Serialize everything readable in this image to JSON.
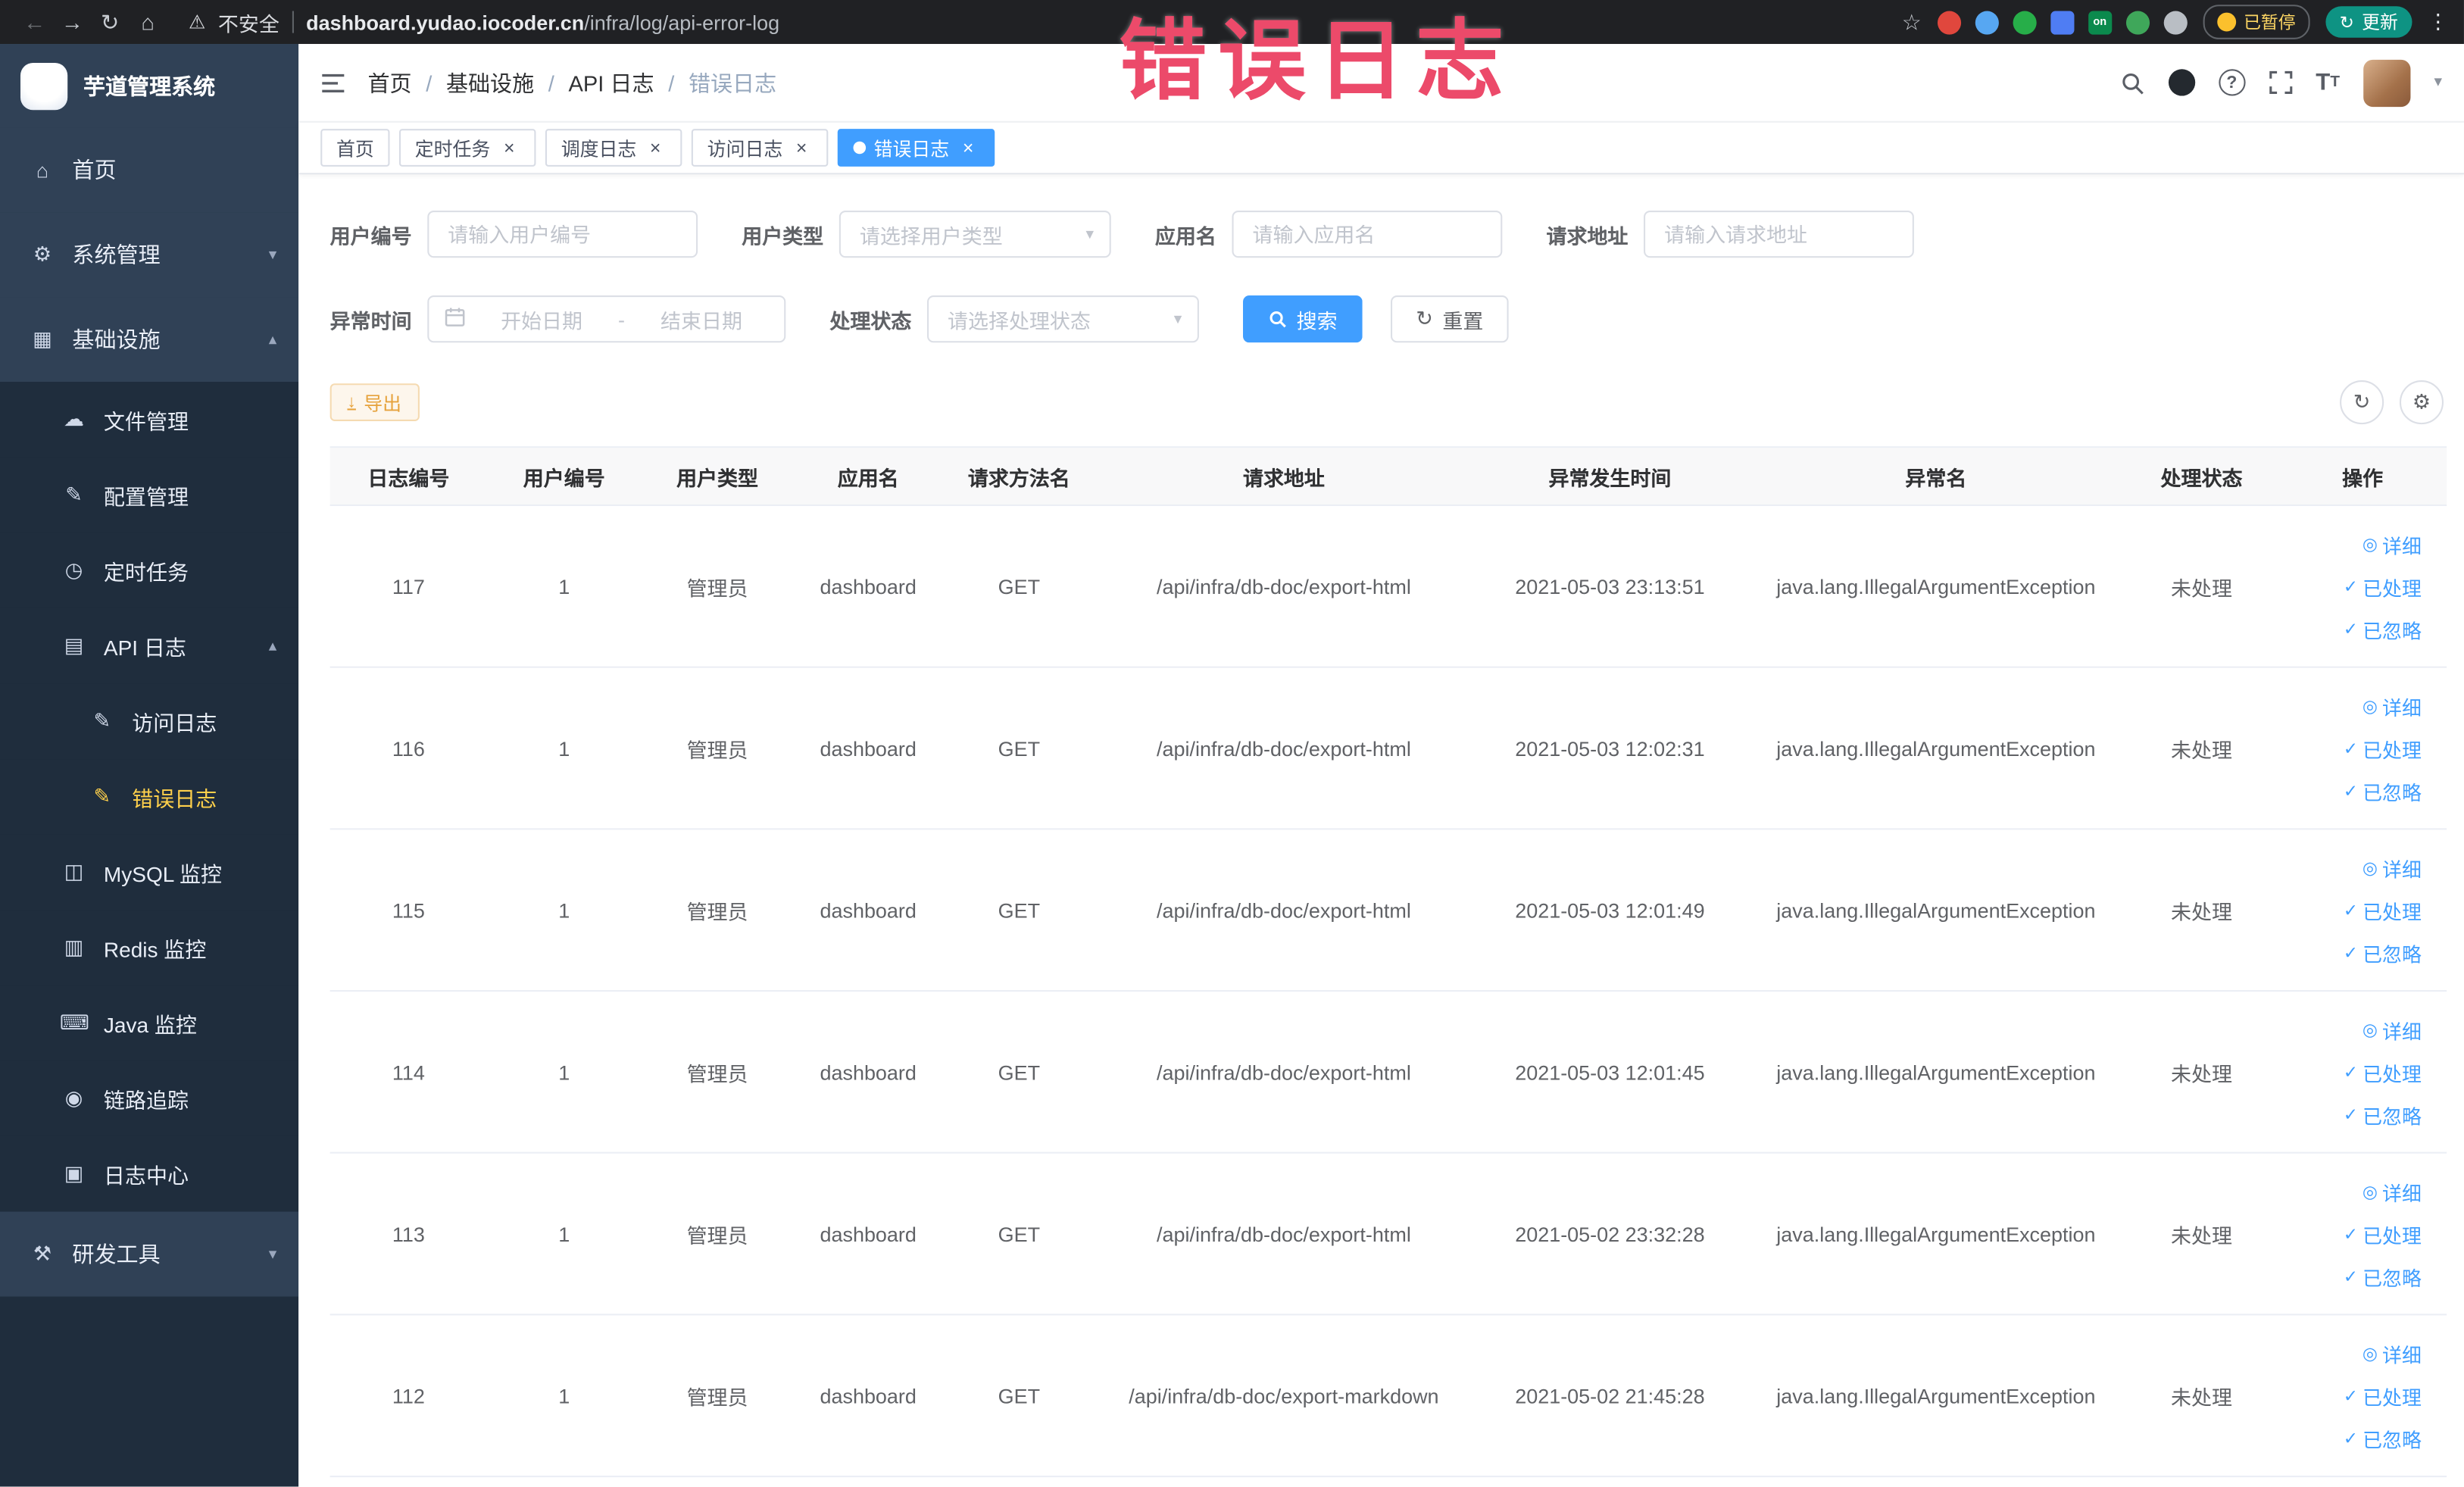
{
  "annotation": {
    "text": "错误日志"
  },
  "browser": {
    "security_label": "不安全",
    "url_domain": "dashboard.yudao.iocoder.cn",
    "url_path": "/infra/log/api-error-log",
    "paused_label": "已暂停",
    "update_label": "更新",
    "extensions": [
      {
        "name": "extension-red-icon",
        "color": "#e0473d"
      },
      {
        "name": "extension-blue-icon",
        "color": "#57a7f2"
      },
      {
        "name": "extension-green-circle-icon",
        "color": "#27ae49"
      },
      {
        "name": "extension-blue-grid-icon",
        "color": "#4f7df3",
        "shape": "square"
      },
      {
        "name": "extension-on-badge-icon",
        "color": "#0b8a4d",
        "shape": "square",
        "text": "on"
      },
      {
        "name": "extension-leaf-icon",
        "color": "#3fa75a"
      },
      {
        "name": "extension-paw-icon",
        "color": "#b9bec4"
      }
    ]
  },
  "sidebar": {
    "title": "芋道管理系统",
    "items": [
      {
        "label": "首页",
        "level": 1,
        "icon": "home-icon"
      },
      {
        "label": "系统管理",
        "level": 1,
        "icon": "gear-icon",
        "chevron": "down"
      },
      {
        "label": "基础设施",
        "level": 1,
        "icon": "infra-icon",
        "chevron": "up"
      },
      {
        "label": "文件管理",
        "level": 2,
        "icon": "file-icon"
      },
      {
        "label": "配置管理",
        "level": 2,
        "icon": "config-icon"
      },
      {
        "label": "定时任务",
        "level": 2,
        "icon": "timer-icon"
      },
      {
        "label": "API 日志",
        "level": 2,
        "icon": "api-log-icon",
        "chevron": "up"
      },
      {
        "label": "访问日志",
        "level": 3,
        "icon": "access-log-icon"
      },
      {
        "label": "错误日志",
        "level": 3,
        "icon": "error-log-icon",
        "active": true
      },
      {
        "label": "MySQL 监控",
        "level": 2,
        "icon": "mysql-icon"
      },
      {
        "label": "Redis 监控",
        "level": 2,
        "icon": "redis-icon"
      },
      {
        "label": "Java 监控",
        "level": 2,
        "icon": "java-icon"
      },
      {
        "label": "链路追踪",
        "level": 2,
        "icon": "trace-icon"
      },
      {
        "label": "日志中心",
        "level": 2,
        "icon": "log-center-icon"
      },
      {
        "label": "研发工具",
        "level": 1,
        "icon": "devtools-icon",
        "chevron": "down"
      }
    ]
  },
  "header": {
    "breadcrumb": [
      "首页",
      "基础设施",
      "API 日志",
      "错误日志"
    ]
  },
  "tags": [
    {
      "label": "首页",
      "closable": false,
      "active": false
    },
    {
      "label": "定时任务",
      "closable": true,
      "active": false
    },
    {
      "label": "调度日志",
      "closable": true,
      "active": false
    },
    {
      "label": "访问日志",
      "closable": true,
      "active": false
    },
    {
      "label": "错误日志",
      "closable": true,
      "active": true
    }
  ],
  "filters": {
    "user_id_label": "用户编号",
    "user_id_placeholder": "请输入用户编号",
    "user_type_label": "用户类型",
    "user_type_placeholder": "请选择用户类型",
    "app_name_label": "应用名",
    "app_name_placeholder": "请输入应用名",
    "request_url_label": "请求地址",
    "request_url_placeholder": "请输入请求地址",
    "time_label": "异常时间",
    "time_start_placeholder": "开始日期",
    "time_end_placeholder": "结束日期",
    "time_separator": "-",
    "status_label": "处理状态",
    "status_placeholder": "请选择处理状态",
    "search_label": "搜索",
    "reset_label": "重置"
  },
  "toolbar": {
    "export_label": "导出"
  },
  "table": {
    "columns": [
      "日志编号",
      "用户编号",
      "用户类型",
      "应用名",
      "请求方法名",
      "请求地址",
      "异常发生时间",
      "异常名",
      "处理状态",
      "操作"
    ],
    "action_labels": [
      "详细",
      "已处理",
      "已忽略"
    ],
    "rows": [
      {
        "id": "117",
        "user_id": "1",
        "user_type": "管理员",
        "app": "dashboard",
        "method": "GET",
        "url": "/api/infra/db-doc/export-html",
        "time": "2021-05-03 23:13:51",
        "exception": "java.lang.IllegalArgumentException",
        "status": "未处理"
      },
      {
        "id": "116",
        "user_id": "1",
        "user_type": "管理员",
        "app": "dashboard",
        "method": "GET",
        "url": "/api/infra/db-doc/export-html",
        "time": "2021-05-03 12:02:31",
        "exception": "java.lang.IllegalArgumentException",
        "status": "未处理"
      },
      {
        "id": "115",
        "user_id": "1",
        "user_type": "管理员",
        "app": "dashboard",
        "method": "GET",
        "url": "/api/infra/db-doc/export-html",
        "time": "2021-05-03 12:01:49",
        "exception": "java.lang.IllegalArgumentException",
        "status": "未处理"
      },
      {
        "id": "114",
        "user_id": "1",
        "user_type": "管理员",
        "app": "dashboard",
        "method": "GET",
        "url": "/api/infra/db-doc/export-html",
        "time": "2021-05-03 12:01:45",
        "exception": "java.lang.IllegalArgumentException",
        "status": "未处理"
      },
      {
        "id": "113",
        "user_id": "1",
        "user_type": "管理员",
        "app": "dashboard",
        "method": "GET",
        "url": "/api/infra/db-doc/export-html",
        "time": "2021-05-02 23:32:28",
        "exception": "java.lang.IllegalArgumentException",
        "status": "未处理"
      },
      {
        "id": "112",
        "user_id": "1",
        "user_type": "管理员",
        "app": "dashboard",
        "method": "GET",
        "url": "/api/infra/db-doc/export-markdown",
        "time": "2021-05-02 21:45:28",
        "exception": "java.lang.IllegalArgumentException",
        "status": "未处理"
      }
    ]
  }
}
